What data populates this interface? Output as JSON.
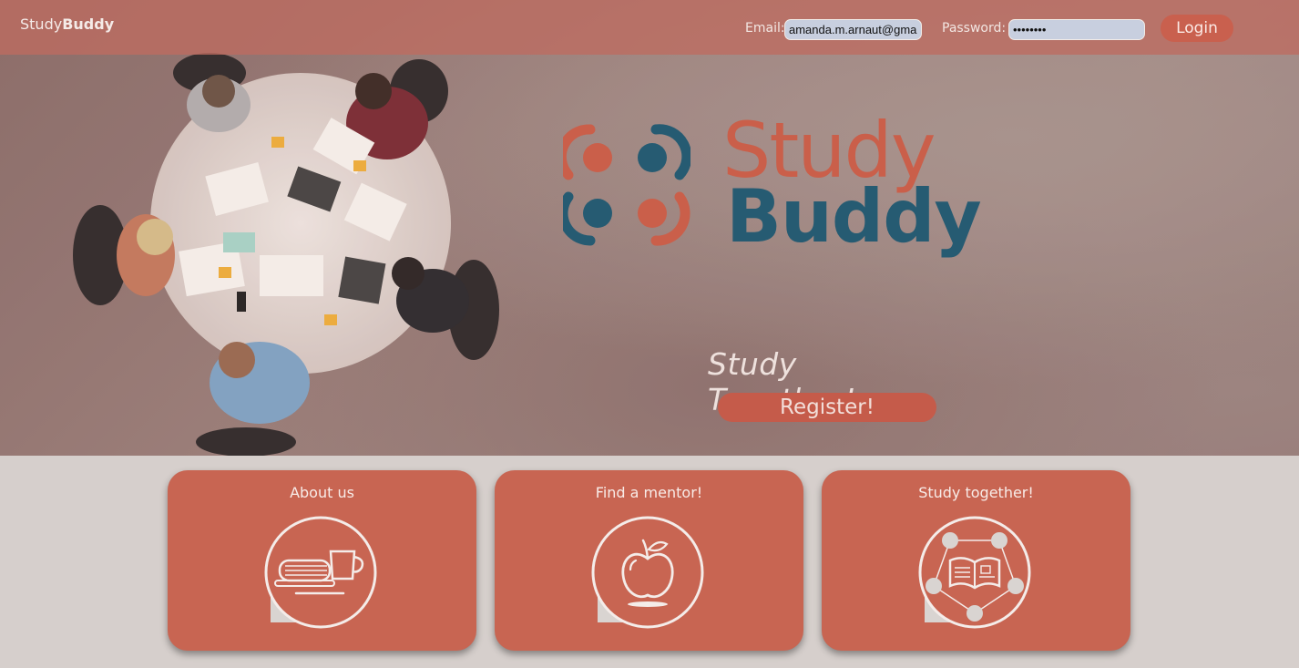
{
  "header": {
    "brand_part1": "Study",
    "brand_part2": "Buddy",
    "email_label": "Email:",
    "email_value": "amanda.m.arnaut@gma",
    "password_label": "Password:",
    "password_value": "••••••••",
    "login_label": "Login"
  },
  "hero": {
    "logo_study": "Study",
    "logo_buddy": "Buddy",
    "tagline": "Study Together!",
    "register_label": "Register!"
  },
  "cards": [
    {
      "title": "About us",
      "icon": "book-coffee-icon"
    },
    {
      "title": "Find a mentor!",
      "icon": "apple-icon"
    },
    {
      "title": "Study together!",
      "icon": "study-network-icon"
    }
  ],
  "colors": {
    "accent": "#c86552",
    "logo_orange": "#cc5e48",
    "logo_blue": "#1b5a74",
    "header_bg": "#be6c60",
    "page_bg": "#d6cfcc"
  }
}
